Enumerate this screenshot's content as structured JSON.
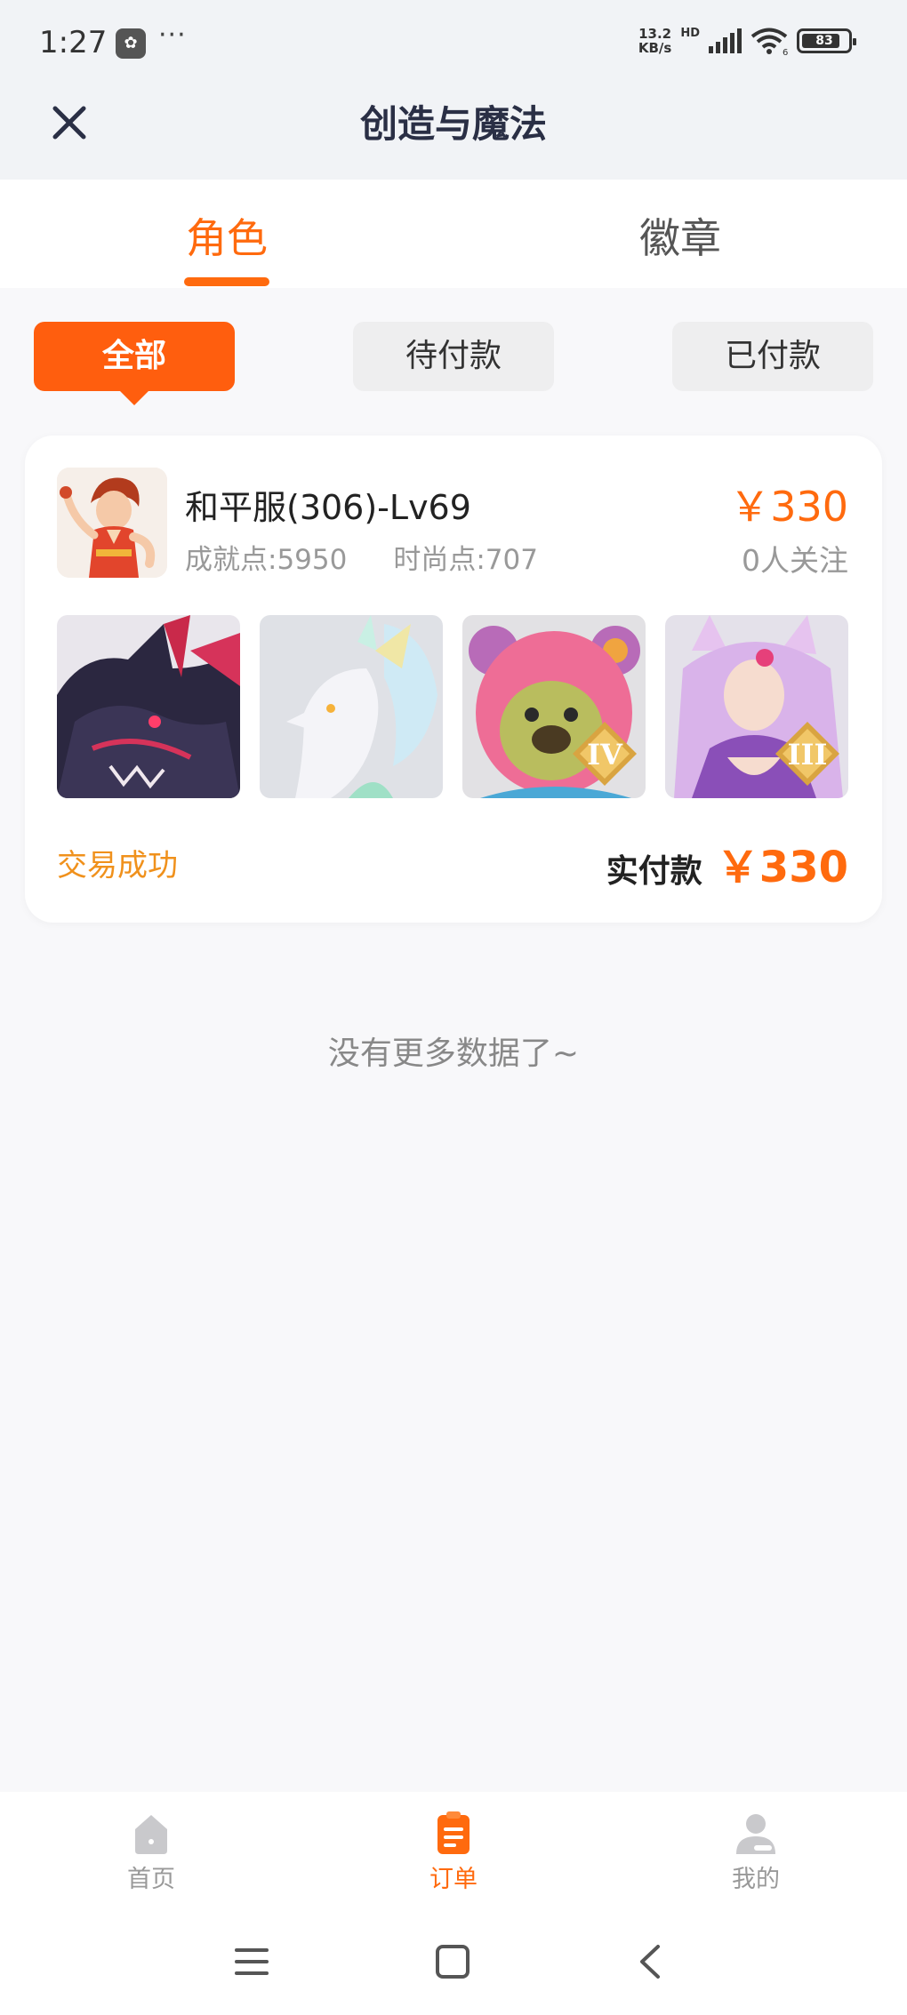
{
  "status_bar": {
    "time": "1:27",
    "more": "···",
    "net_speed_value": "13.2",
    "net_speed_unit": "KB/s",
    "hd": "HD",
    "wifi_level": "6",
    "battery": "83"
  },
  "header": {
    "title": "创造与魔法"
  },
  "tabs": [
    {
      "label": "角色",
      "active": true
    },
    {
      "label": "徽章",
      "active": false
    }
  ],
  "filters": [
    {
      "label": "全部",
      "active": true
    },
    {
      "label": "待付款",
      "active": false
    },
    {
      "label": "已付款",
      "active": false
    }
  ],
  "order": {
    "server": "和平服(306)-Lv69",
    "achievement": "成就点:5950",
    "fashion": "时尚点:707",
    "price": "￥330",
    "followers": "0人关注",
    "items": [
      {
        "name": "dark-dragon",
        "rank": ""
      },
      {
        "name": "white-fox-mount",
        "rank": ""
      },
      {
        "name": "pink-bear-hood",
        "rank": "IV"
      },
      {
        "name": "fox-spirit-lady",
        "rank": "III"
      }
    ],
    "status": "交易成功",
    "paid_label": "实付款",
    "paid_value": "￥330"
  },
  "no_more": "没有更多数据了~",
  "bottom_nav": [
    {
      "label": "首页",
      "icon": "home-icon",
      "active": false
    },
    {
      "label": "订单",
      "icon": "orders-icon",
      "active": true
    },
    {
      "label": "我的",
      "icon": "profile-icon",
      "active": false
    }
  ],
  "colors": {
    "accent": "#ff6a0e",
    "status_success": "#f0911c",
    "chip_bg": "#eeeeef"
  }
}
